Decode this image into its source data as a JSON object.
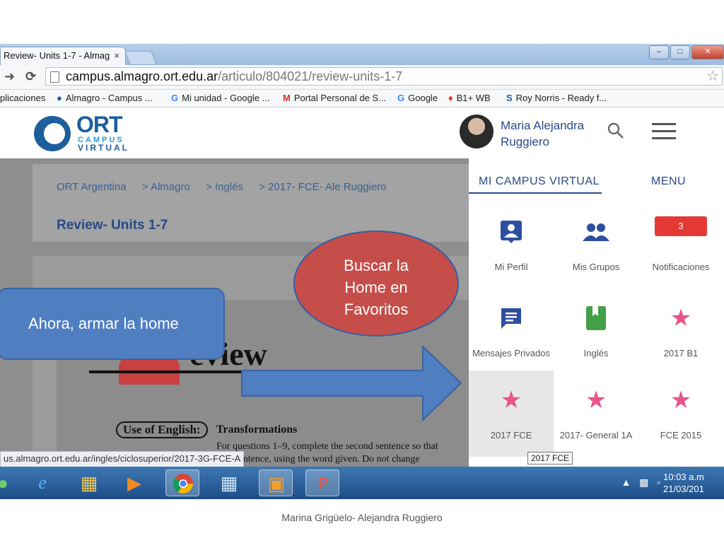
{
  "browser": {
    "tab_title": "Review- Units 1-7 - Almag",
    "tab_close": "×",
    "url_host": "campus.almagro.ort.edu.ar",
    "url_path": "/articulo/804021/review-units-1-7",
    "bookmarks": [
      {
        "icon": "grid-icon",
        "label": "plicaciones"
      },
      {
        "icon": "almagro-icon",
        "label": "Almagro - Campus ..."
      },
      {
        "icon": "google-icon",
        "label": "Mi unidad - Google ..."
      },
      {
        "icon": "gmail-icon",
        "label": "Portal Personal de S..."
      },
      {
        "icon": "google-icon",
        "label": "Google"
      },
      {
        "icon": "b1-icon",
        "label": "B1+ WB"
      },
      {
        "icon": "link-icon",
        "label": "Roy Norris - Ready f..."
      }
    ],
    "status_url": "us.almagro.ort.edu.ar/ingles/ciclosuperior/2017-3G-FCE-A"
  },
  "site": {
    "logo_main": "ORT",
    "logo_sub1": "CAMPUS",
    "logo_sub2": "VIRTUAL",
    "user_name_1": "Maria Alejandra",
    "user_name_2": "Ruggiero"
  },
  "breadcrumb": [
    "ORT Argentina",
    "> Almagro",
    "> Inglés",
    "> 2017- FCE- Ale Ruggiero"
  ],
  "page_title": "Review- Units 1-7",
  "worksheet": {
    "heading": "eview",
    "use_of_english": "Use of English:",
    "section": "Transformations",
    "line1": "For questions 1–9, complete the second sentence so that",
    "line2": "first sentence, using the word given. Do not change"
  },
  "panel": {
    "tab_campus": "MI CAMPUS VIRTUAL",
    "tab_menu": "MENU",
    "tiles": [
      {
        "label": "Mi Perfil",
        "icon": "profile-icon"
      },
      {
        "label": "Mis Grupos",
        "icon": "groups-icon"
      },
      {
        "label": "Notificaciones",
        "icon": "badge",
        "badge": "3"
      },
      {
        "label": "Mensajes Privados",
        "icon": "message-icon"
      },
      {
        "label": "Inglés",
        "icon": "book-icon"
      },
      {
        "label": "2017 B1",
        "icon": "star-icon"
      },
      {
        "label": "2017 FCE",
        "icon": "star-icon"
      },
      {
        "label": "2017- General 1A",
        "icon": "star-icon"
      },
      {
        "label": "FCE 2015",
        "icon": "star-icon"
      }
    ],
    "tooltip": "2017 FCE"
  },
  "taskbar": {
    "clock_time": "10:03 a.m",
    "clock_date": "21/03/201"
  },
  "callouts": {
    "rect_text": "Ahora, armar la home",
    "oval_line1": "Buscar la",
    "oval_line2": "Home en",
    "oval_line3": "Favoritos"
  },
  "footer": "Marina Grigüelo- Alejandra Ruggiero",
  "colors": {
    "brand_blue": "#2c4a8a",
    "notification_red": "#e53935",
    "star_pink": "#e8558b",
    "callout_blue": "#4f7fc0",
    "callout_red": "#c54e4a"
  }
}
